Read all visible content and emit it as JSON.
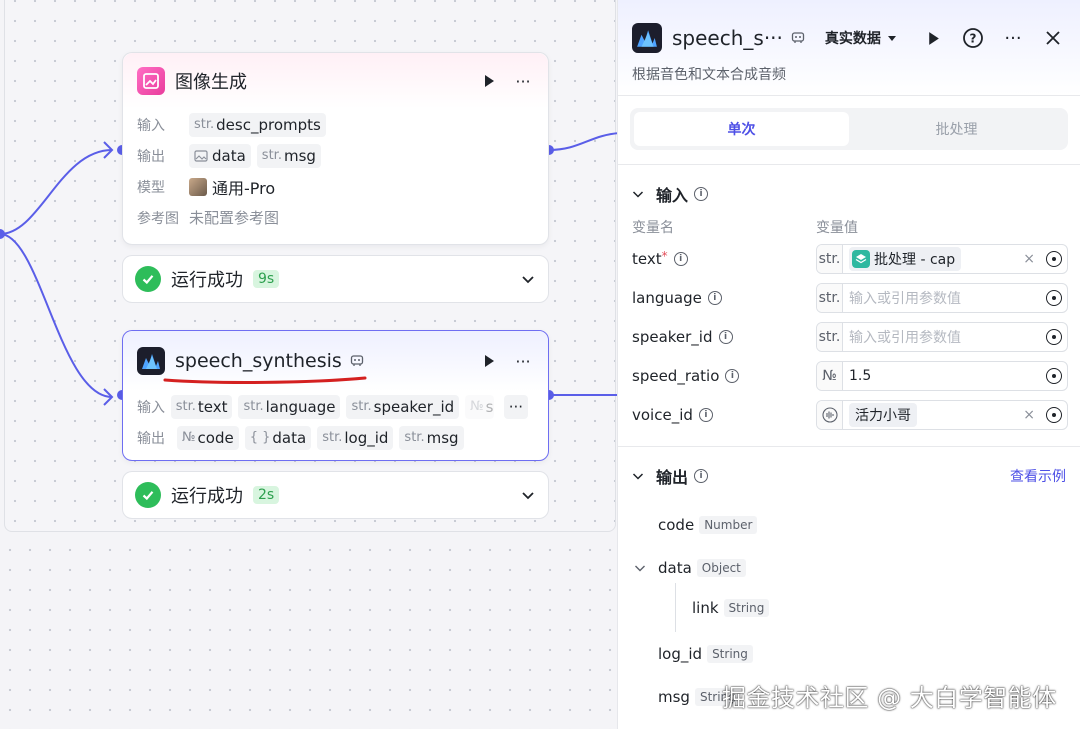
{
  "image_node": {
    "title": "图像生成",
    "input_label": "输入",
    "output_label": "输出",
    "model_label": "模型",
    "ref_label": "参考图",
    "inputs": [
      {
        "type": "str.",
        "name": "desc_prompts"
      }
    ],
    "outputs": [
      {
        "type": "",
        "name": "data"
      },
      {
        "type": "str.",
        "name": "msg"
      }
    ],
    "model": "通用-Pro",
    "ref": "未配置参考图",
    "status": "运行成功",
    "time": "9s"
  },
  "speech_node": {
    "title": "speech_synthesis",
    "input_label": "输入",
    "output_label": "输出",
    "inputs": [
      {
        "type": "str.",
        "name": "text"
      },
      {
        "type": "str.",
        "name": "language"
      },
      {
        "type": "str.",
        "name": "speaker_id"
      },
      {
        "type": "№",
        "name": "s"
      }
    ],
    "outputs": [
      {
        "type": "№",
        "name": "code"
      },
      {
        "type": "{ }",
        "name": "data"
      },
      {
        "type": "str.",
        "name": "log_id"
      },
      {
        "type": "str.",
        "name": "msg"
      }
    ],
    "more": "···",
    "status": "运行成功",
    "time": "2s"
  },
  "panel": {
    "title": "speech_s···",
    "mode": "真实数据",
    "description": "根据音色和文本合成音频",
    "tabs": [
      "单次",
      "批处理"
    ],
    "input_section": "输入",
    "col_name": "变量名",
    "col_value": "变量值",
    "params": [
      {
        "name": "text",
        "required": "*",
        "type": "str.",
        "chip": "批处理 - cap",
        "placeholder": ""
      },
      {
        "name": "language",
        "required": "",
        "type": "str.",
        "chip": "",
        "placeholder": "输入或引用参数值"
      },
      {
        "name": "speaker_id",
        "required": "",
        "type": "str.",
        "chip": "",
        "placeholder": "输入或引用参数值"
      },
      {
        "name": "speed_ratio",
        "required": "",
        "type": "№",
        "value": "1.5"
      },
      {
        "name": "voice_id",
        "required": "",
        "type": "",
        "chip": "活力小哥"
      }
    ],
    "output_section": "输出",
    "example_link": "查看示例",
    "outputs": [
      {
        "name": "code",
        "type": "Number"
      },
      {
        "name": "data",
        "type": "Object"
      },
      {
        "name": "link",
        "type": "String"
      },
      {
        "name": "log_id",
        "type": "String"
      },
      {
        "name": "msg",
        "type": "String"
      }
    ]
  },
  "watermark": "掘金技术社区 @ 大白学智能体",
  "colors": {
    "accent": "#4e50e6",
    "success": "#2ebd5a",
    "edge": "#5a5ee8",
    "underline": "#d42020"
  }
}
